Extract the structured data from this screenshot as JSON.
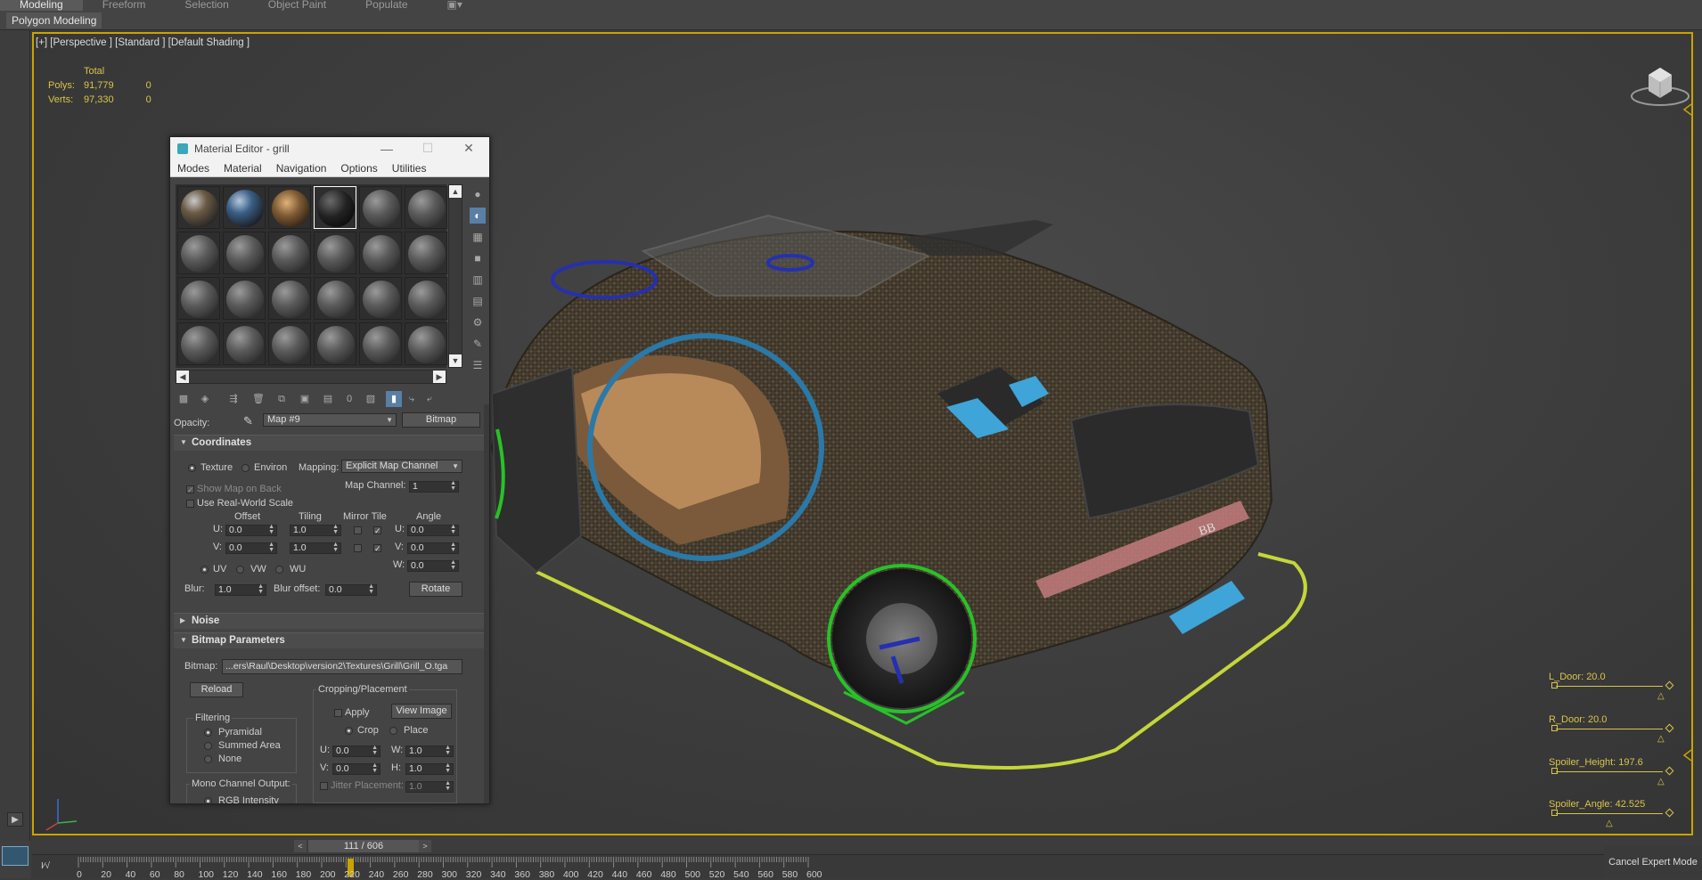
{
  "ribbon": {
    "tabs": [
      "Modeling",
      "Freeform",
      "Selection",
      "Object Paint",
      "Populate"
    ],
    "panel_label": "Polygon Modeling"
  },
  "viewport": {
    "label": "[+] [Perspective ] [Standard ] [Default Shading ]",
    "stats": {
      "header": "Total",
      "polys_label": "Polys:",
      "polys_total": "91,779",
      "polys_sel": "0",
      "verts_label": "Verts:",
      "verts_total": "97,330",
      "verts_sel": "0"
    }
  },
  "material_editor": {
    "title": "Material Editor - grill",
    "menu": [
      "Modes",
      "Material",
      "Navigation",
      "Options",
      "Utilities"
    ],
    "opacity_label": "Opacity:",
    "map_name": "Map #9",
    "map_type": "Bitmap",
    "coordinates": {
      "title": "Coordinates",
      "texture": "Texture",
      "environ": "Environ",
      "mapping_label": "Mapping:",
      "mapping_value": "Explicit Map Channel",
      "map_channel_label": "Map Channel:",
      "map_channel_value": "1",
      "show_map_on_back": "Show Map on Back",
      "use_real_world": "Use Real-World Scale",
      "offset": "Offset",
      "tiling": "Tiling",
      "mirror_tile": "Mirror Tile",
      "angle": "Angle",
      "u_label": "U:",
      "v_label": "V:",
      "w_label": "W:",
      "u_offset": "0.0",
      "v_offset": "0.0",
      "u_tiling": "1.0",
      "v_tiling": "1.0",
      "u_angle": "0.0",
      "v_angle": "0.0",
      "w_angle": "0.0",
      "uv": "UV",
      "vw": "VW",
      "wu": "WU",
      "blur_label": "Blur:",
      "blur_value": "1.0",
      "blur_offset_label": "Blur offset:",
      "blur_offset_value": "0.0",
      "rotate": "Rotate"
    },
    "noise": {
      "title": "Noise"
    },
    "bitmap_params": {
      "title": "Bitmap Parameters",
      "bitmap_label": "Bitmap:",
      "bitmap_path": "...ers\\Raul\\Desktop\\version2\\Textures\\Grill\\Grill_O.tga",
      "reload": "Reload",
      "cropping": "Cropping/Placement",
      "apply": "Apply",
      "view_image": "View Image",
      "crop": "Crop",
      "place": "Place",
      "filtering": "Filtering",
      "pyramidal": "Pyramidal",
      "summed_area": "Summed Area",
      "none": "None",
      "u_label": "U:",
      "v_label": "V:",
      "w_label": "W:",
      "h_label": "H:",
      "cu": "0.0",
      "cv": "0.0",
      "cw": "1.0",
      "ch": "1.0",
      "jitter": "Jitter Placement:",
      "jitter_value": "1.0",
      "mono_channel": "Mono Channel Output:",
      "rgb_intensity": "RGB Intensity"
    }
  },
  "params": [
    {
      "label": "L_Door: 20.0"
    },
    {
      "label": "R_Door: 20.0"
    },
    {
      "label": "Spoiler_Height: 197.6"
    },
    {
      "label": "Spoiler_Angle: 42.525"
    }
  ],
  "timeline": {
    "frame_display": "111 / 606",
    "ticks": [
      "0",
      "20",
      "40",
      "60",
      "80",
      "100",
      "120",
      "140",
      "160",
      "180",
      "200",
      "220",
      "240",
      "260",
      "280",
      "300",
      "320",
      "340",
      "360",
      "380",
      "400",
      "420",
      "440",
      "460",
      "480",
      "500",
      "520",
      "540",
      "560",
      "580",
      "600"
    ],
    "cancel_expert": "Cancel Expert Mode"
  },
  "colors": {
    "accent": "#c9a400",
    "stats": "#d9c44a",
    "viewport_bg": "#3e3e3e"
  }
}
